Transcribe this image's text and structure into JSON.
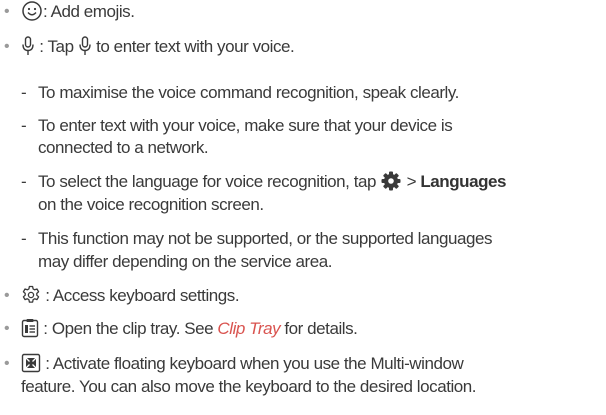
{
  "items": {
    "emoji": {
      "text": ": Add emojis."
    },
    "voice": {
      "text_a": " : Tap ",
      "text_b": " to enter text with your voice."
    },
    "sub1": {
      "text": "To maximise the voice command recognition, speak clearly."
    },
    "sub2": {
      "line1": "To enter text with your voice, make sure that your device is",
      "line2": "connected to a network."
    },
    "sub3": {
      "text_a": "To select the language for voice recognition, tap ",
      "text_b": " > ",
      "bold": "Languages",
      "line2": "on the voice recognition screen."
    },
    "sub4": {
      "line1": "This function may not be supported, or the supported languages",
      "line2": "may differ depending on the service area."
    },
    "settings": {
      "text": " : Access keyboard settings."
    },
    "clip": {
      "text_a": " : Open the clip tray. See ",
      "link": "Clip Tray",
      "text_b": " for details."
    },
    "floating": {
      "line1": " : Activate floating keyboard when you use the Multi-window",
      "line2": "feature. You can also move the keyboard to the desired location."
    }
  },
  "symbols": {
    "bullet": "•",
    "dash": "-"
  },
  "colors": {
    "text": "#3a3a3a",
    "bullet": "#9a9a9a",
    "link": "#d9534f"
  }
}
